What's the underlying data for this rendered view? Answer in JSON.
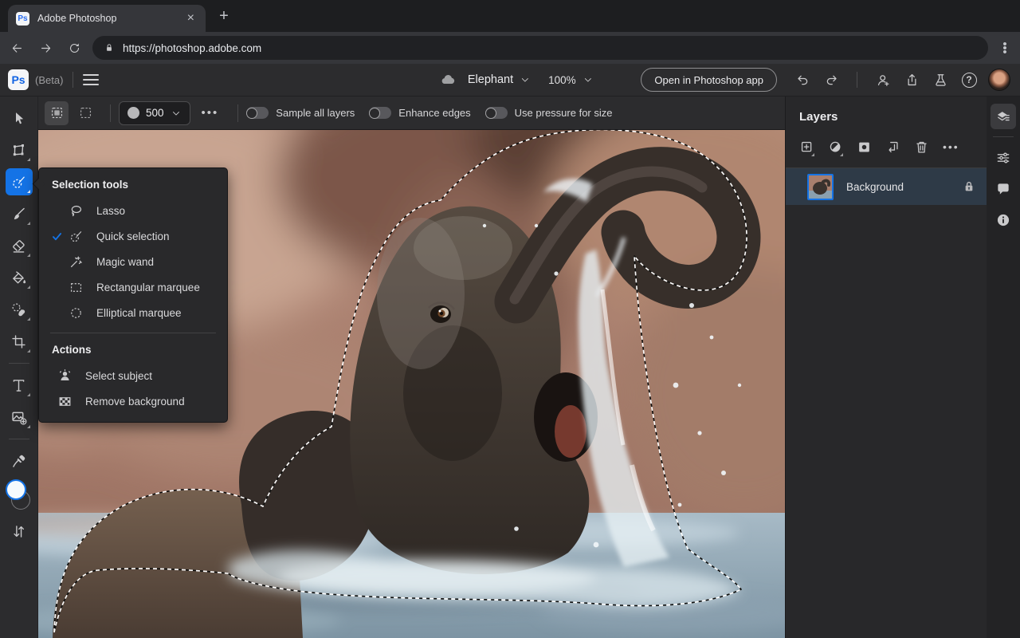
{
  "browser": {
    "tab_title": "Adobe Photoshop",
    "url": "https://photoshop.adobe.com",
    "favicon_text": "Ps"
  },
  "header": {
    "logo_text": "Ps",
    "beta_label": "(Beta)",
    "doc_name": "Elephant",
    "zoom_level": "100%",
    "open_app_button": "Open in Photoshop app"
  },
  "options_bar": {
    "brush_size": "500",
    "toggles": [
      {
        "label": "Sample all layers",
        "on": false
      },
      {
        "label": "Enhance edges",
        "on": false
      },
      {
        "label": "Use pressure for size",
        "on": false
      }
    ]
  },
  "toolbar": {
    "active_tool": "quick-selection",
    "tools": [
      "move",
      "transform",
      "quick-selection",
      "brush",
      "eraser",
      "fill",
      "heal",
      "crop",
      "type",
      "add-image",
      "eyedropper",
      "color-swatches",
      "swap-colors"
    ]
  },
  "flyout": {
    "title": "Selection tools",
    "items": [
      {
        "label": "Lasso",
        "checked": false
      },
      {
        "label": "Quick selection",
        "checked": true
      },
      {
        "label": "Magic wand",
        "checked": false
      },
      {
        "label": "Rectangular marquee",
        "checked": false
      },
      {
        "label": "Elliptical marquee",
        "checked": false
      }
    ],
    "actions_title": "Actions",
    "actions": [
      {
        "label": "Select subject"
      },
      {
        "label": "Remove background"
      }
    ]
  },
  "layers_panel": {
    "title": "Layers",
    "layers": [
      {
        "name": "Background",
        "locked": true,
        "selected": true
      }
    ]
  },
  "colors": {
    "accent": "#1473e6",
    "selected_layer_bg": "#2e3a47",
    "chrome_dark": "#1d1e20",
    "panel_bg": "#28282a"
  }
}
